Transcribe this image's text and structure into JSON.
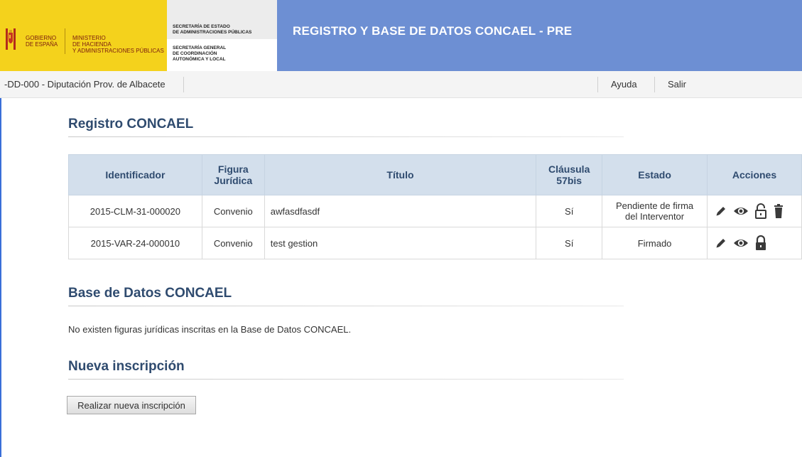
{
  "header": {
    "gobierno": [
      "GOBIERNO",
      "DE ESPAÑA"
    ],
    "ministerio": [
      "MINISTERIO",
      "DE HACIENDA",
      "Y ADMINISTRACIONES PÚBLICAS"
    ],
    "sec_estado": [
      "SECRETARÍA DE ESTADO",
      "DE ADMINISTRACIONES PÚBLICAS"
    ],
    "sec_general": [
      "SECRETARÍA GENERAL",
      "DE COORDINACIÓN",
      "AUTONÓMICA Y LOCAL"
    ],
    "title": "REGISTRO Y BASE DE DATOS CONCAEL - PRE"
  },
  "userbar": {
    "entity": "-DD-000 - Diputación Prov. de Albacete",
    "help": "Ayuda",
    "logout": "Salir"
  },
  "registro": {
    "title": "Registro CONCAEL",
    "columns": {
      "identificador": "Identificador",
      "figura": [
        "Figura",
        "Jurídica"
      ],
      "titulo": "Título",
      "clausula": [
        "Cláusula",
        "57bis"
      ],
      "estado": "Estado",
      "acciones": "Acciones"
    },
    "rows": [
      {
        "id": "2015-CLM-31-000020",
        "figura": "Convenio",
        "titulo": "awfasdfasdf",
        "clausula": "Sí",
        "estado": [
          "Pendiente de firma",
          "del Interventor"
        ]
      },
      {
        "id": "2015-VAR-24-000010",
        "figura": "Convenio",
        "titulo": "test gestion",
        "clausula": "Sí",
        "estado": [
          "Firmado"
        ]
      }
    ]
  },
  "base_datos": {
    "title": "Base de Datos CONCAEL",
    "empty_message": "No existen figuras jurídicas inscritas en la Base de Datos CONCAEL."
  },
  "nueva": {
    "title": "Nueva inscripción",
    "button_label": "Realizar nueva inscripción"
  },
  "colors": {
    "banner": "#6d8fd3",
    "accent_yellow": "#f4d21c",
    "title_blue": "#2f4b6f",
    "status_pending": "#cc1f1f",
    "status_signed": "#1e9a1e"
  },
  "icons": {
    "row_1_actions": [
      "pencil-icon",
      "eye-icon",
      "unlocked-padlock-icon",
      "trash-icon"
    ],
    "row_2_actions": [
      "pencil-icon",
      "eye-icon",
      "locked-padlock-icon"
    ]
  }
}
